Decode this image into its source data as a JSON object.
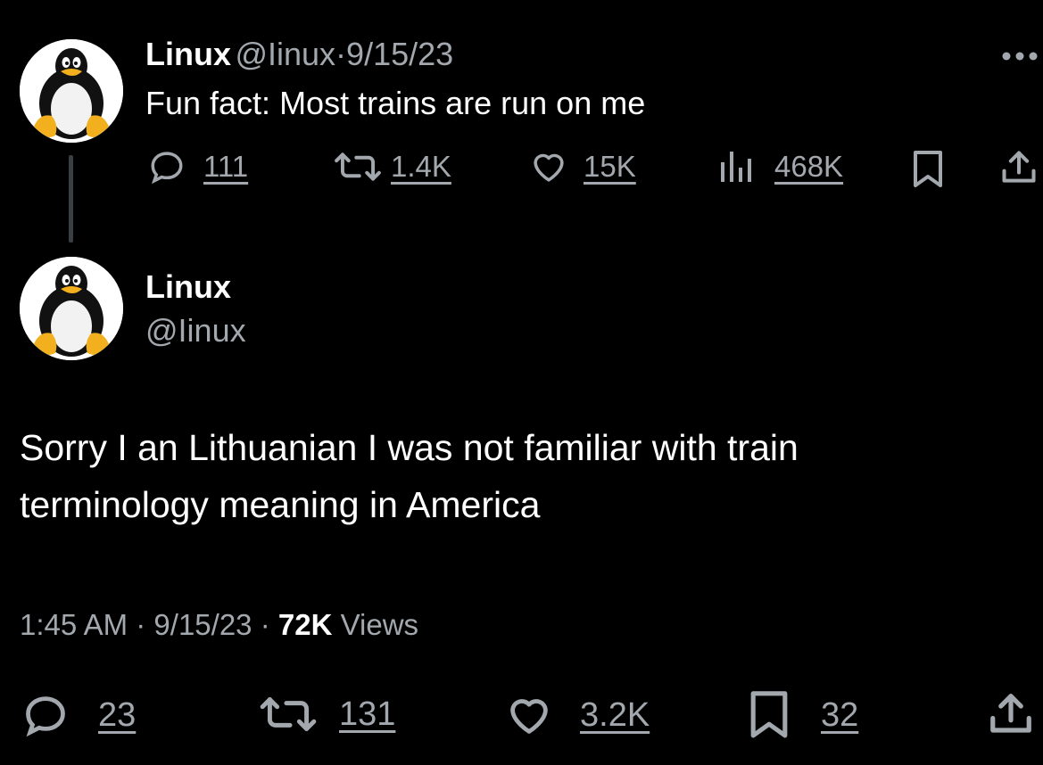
{
  "reply_to": {
    "author_name": "Linux",
    "handle": "@Iinux",
    "separator": "·",
    "date": "9/15/23",
    "text": "Fun fact: Most trains are run on me",
    "more_icon": "more-dots-icon",
    "actions": {
      "replies": "111",
      "reposts": "1.4K",
      "likes": "15K",
      "views": "468K"
    }
  },
  "tweet": {
    "author_name": "Linux",
    "handle": "@Iinux",
    "text_line1": "Sorry I an Lithuanian I was not familiar with train",
    "text_line2": "terminology meaning in America",
    "time": "1:45 AM",
    "separator": "·",
    "date": "9/15/23",
    "views_count": "72K",
    "views_label": "Views",
    "actions": {
      "replies": "23",
      "reposts": "131",
      "likes": "3.2K",
      "bookmarks": "32"
    }
  },
  "colors": {
    "background": "#000000",
    "text": "#ffffff",
    "secondary": "#a2a8ad"
  }
}
